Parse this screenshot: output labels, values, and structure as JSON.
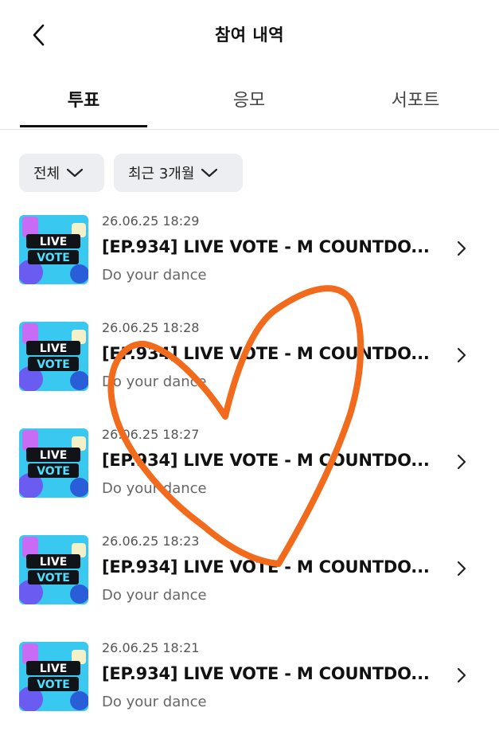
{
  "header": {
    "title": "참여 내역",
    "back_icon": "chevron-left-icon"
  },
  "tabs": [
    {
      "label": "투표",
      "active": true
    },
    {
      "label": "응모",
      "active": false
    },
    {
      "label": "서포트",
      "active": false
    }
  ],
  "filters": [
    {
      "label": "전체",
      "icon": "chevron-down-icon"
    },
    {
      "label": "최근 3개월",
      "icon": "chevron-down-icon"
    }
  ],
  "items": [
    {
      "date": "26.06.25 18:29",
      "title": "[EP.934] LIVE VOTE - M COUNTDO...",
      "subtitle": "Do your dance"
    },
    {
      "date": "26.06.25 18:28",
      "title": "[EP.934] LIVE VOTE - M COUNTDO...",
      "subtitle": "Do your dance"
    },
    {
      "date": "26.06.25 18:27",
      "title": "[EP.934] LIVE VOTE - M COUNTDO...",
      "subtitle": "Do your dance"
    },
    {
      "date": "26.06.25 18:23",
      "title": "[EP.934] LIVE VOTE - M COUNTDO...",
      "subtitle": "Do your dance"
    },
    {
      "date": "26.06.25 18:21",
      "title": "[EP.934] LIVE VOTE - M COUNTDO...",
      "subtitle": "Do your dance"
    }
  ],
  "thumbnail": {
    "line1": "LIVE",
    "line2": "VOTE"
  },
  "colors": {
    "heart": "#f26a1b",
    "thumb_bg": "#38c8f0",
    "thumb_accent": "#c86cf5"
  }
}
